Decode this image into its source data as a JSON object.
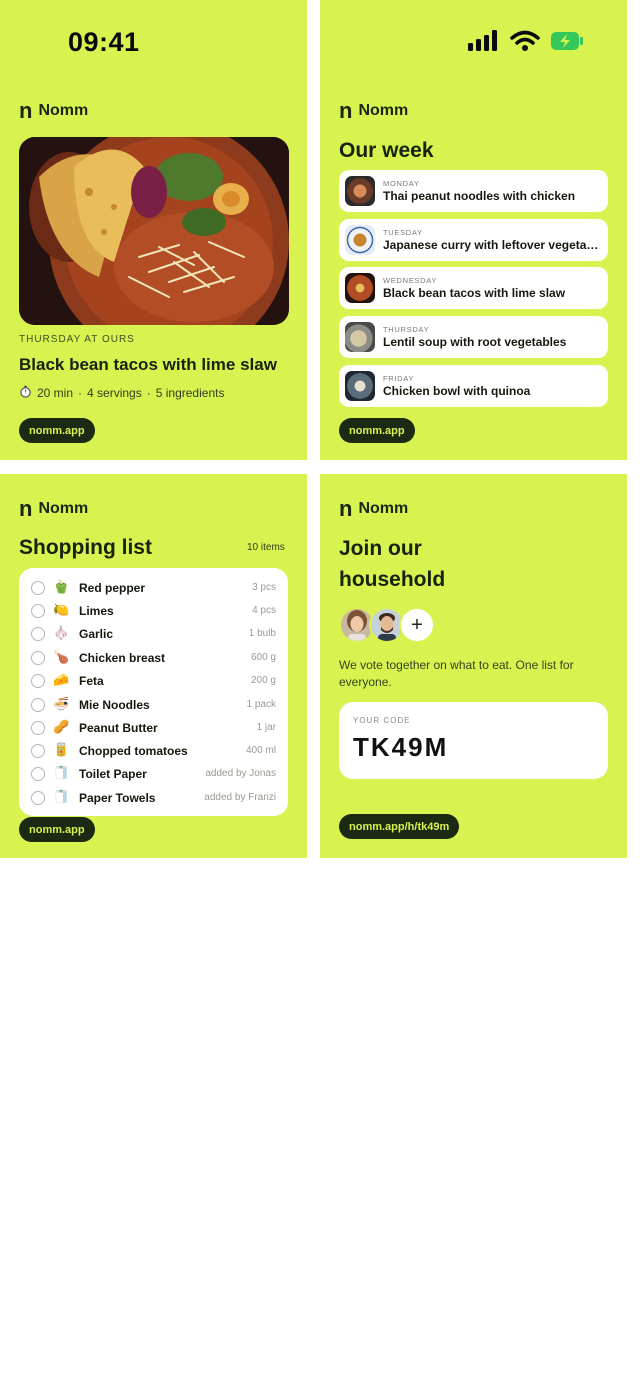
{
  "status_bar": {
    "time": "09:41"
  },
  "brand": {
    "mark": "n",
    "name": "Nomm"
  },
  "recipe_card": {
    "eyebrow": "THURSDAY AT OURS",
    "title": "Black bean tacos with lime slaw",
    "meta_icon": "stopwatch-icon",
    "time": "20 min",
    "servings": "4 servings",
    "ingredients": "5 ingredients",
    "separator": "·",
    "link": "nomm.app"
  },
  "week_card": {
    "title": "Our week",
    "items": [
      {
        "day": "MONDAY",
        "dish": "Thai peanut noodles with chicken"
      },
      {
        "day": "TUESDAY",
        "dish": "Japanese curry with leftover vegetables"
      },
      {
        "day": "WEDNESDAY",
        "dish": "Black bean tacos with lime slaw"
      },
      {
        "day": "THURSDAY",
        "dish": "Lentil soup with root vegetables"
      },
      {
        "day": "FRIDAY",
        "dish": "Chicken bowl with quinoa"
      }
    ],
    "link": "nomm.app"
  },
  "shopping_card": {
    "title": "Shopping list",
    "count": "10 items",
    "items": [
      {
        "emoji": "🫑",
        "name": "Red pepper",
        "qty": "3 pcs"
      },
      {
        "emoji": "🍋",
        "name": "Limes",
        "qty": "4 pcs"
      },
      {
        "emoji": "🧄",
        "name": "Garlic",
        "qty": "1 bulb"
      },
      {
        "emoji": "🍗",
        "name": "Chicken breast",
        "qty": "600 g"
      },
      {
        "emoji": "🧀",
        "name": "Feta",
        "qty": "200 g"
      },
      {
        "emoji": "🍜",
        "name": "Mie Noodles",
        "qty": "1 pack"
      },
      {
        "emoji": "🥜",
        "name": "Peanut Butter",
        "qty": "1 jar"
      },
      {
        "emoji": "🥫",
        "name": "Chopped tomatoes",
        "qty": "400 ml"
      },
      {
        "emoji": "🧻",
        "name": "Toilet Paper",
        "qty": "added by Jonas"
      },
      {
        "emoji": "🧻",
        "name": "Paper Towels",
        "qty": "added by Franzi"
      }
    ],
    "link": "nomm.app"
  },
  "join_card": {
    "title_line1": "Join our",
    "title_line2": "household",
    "add_symbol": "+",
    "description": "We vote together on what to eat. One list for everyone.",
    "code_label": "YOUR CODE",
    "code": "TK49M",
    "link": "nomm.app/h/tk49m"
  },
  "colors": {
    "accent": "#d8f24f",
    "dark": "#1c2913",
    "surface": "#ffffff"
  }
}
